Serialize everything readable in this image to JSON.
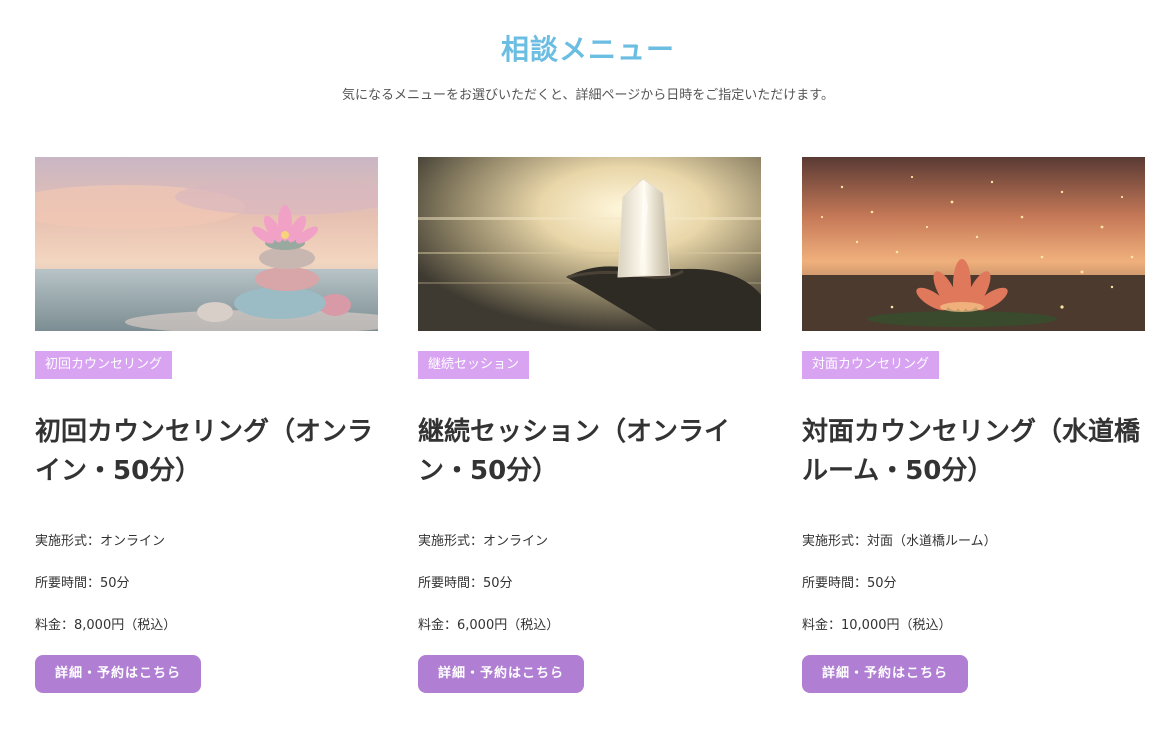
{
  "section": {
    "title": "相談メニュー",
    "subtitle": "気になるメニューをお選びいただくと、詳細ページから日時をご指定いただけます。"
  },
  "cards": [
    {
      "image": "lotus-on-stacked-stones-image",
      "tag": "初回カウンセリング",
      "title": "初回カウンセリング（オンライン・50分）",
      "format": "実施形式：オンライン",
      "duration": "所要時間：50分",
      "price": "料金：8,000円（税込）",
      "button": "詳細・予約はこちら"
    },
    {
      "image": "crystal-in-hands-image",
      "tag": "継続セッション",
      "title": "継続セッション（オンライン・50分）",
      "format": "実施形式：オンライン",
      "duration": "所要時間：50分",
      "price": "料金：6,000円（税込）",
      "button": "詳細・予約はこちら"
    },
    {
      "image": "glowing-lotus-image",
      "tag": "対面カウンセリング",
      "title": "対面カウンセリング（水道橋ルーム・50分）",
      "format": "実施形式：対面（水道橋ルーム）",
      "duration": "所要時間：50分",
      "price": "料金：10,000円（税込）",
      "button": "詳細・予約はこちら"
    }
  ],
  "colors": {
    "title": "#6cbde2",
    "tag_bg": "#d8a4f2",
    "button_bg": "#b07fd4"
  }
}
